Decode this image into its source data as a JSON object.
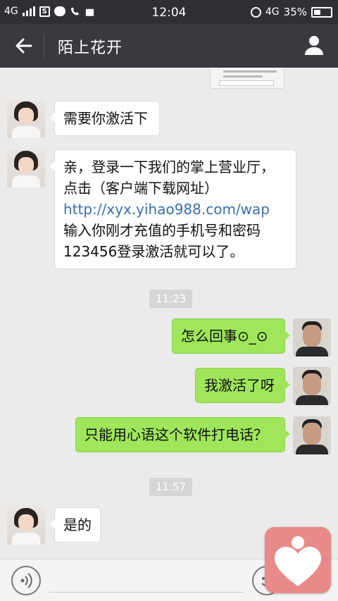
{
  "status_bar": {
    "network": "4G",
    "time": "12:04",
    "data_network": "4G",
    "battery": "35%",
    "app_box_label": "S"
  },
  "nav": {
    "title": "陌上花开"
  },
  "messages": [
    {
      "from": "contact",
      "text": "需要你激活下"
    },
    {
      "from": "contact",
      "text_before": "亲，登录一下我们的掌上营业厅，点击（客户端下载网址） ",
      "link": "http://xyx.yihao988.com/wap",
      "text_after": " 输入你刚才充值的手机号和密码123456登录激活就可以了。"
    },
    {
      "time": "11:23"
    },
    {
      "from": "me",
      "text": "怎么回事⊙_⊙"
    },
    {
      "from": "me",
      "text": "我激活了呀"
    },
    {
      "from": "me",
      "text": "只能用心语这个软件打电话？"
    },
    {
      "time": "11:57"
    },
    {
      "from": "contact",
      "text": "是的"
    }
  ],
  "icons": {
    "back": "arrow-left-icon",
    "profile": "person-icon",
    "voice": "voice-icon",
    "emoji": "emoji-icon",
    "widget": "heart-icon"
  },
  "colors": {
    "statusbar_bg": "#2e3034",
    "navbar_bg": "#393a3f",
    "chat_bg": "#ebebeb",
    "out_bubble": "#9fe65a",
    "link": "#3a6fb0",
    "widget": "#e98a8a"
  }
}
